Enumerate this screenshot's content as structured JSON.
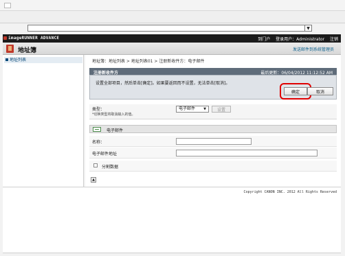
{
  "appbar": {
    "logo": "imageRUNNER ADVANCE",
    "portal": "到门户",
    "login_user_label": "登录用户：",
    "user": "Administrator",
    "logout": "注销"
  },
  "banner": {
    "title": "地址簿",
    "link": "发送邮件到系统管理员"
  },
  "sidebar": {
    "items": [
      {
        "label": "地址列表"
      }
    ]
  },
  "main": {
    "breadcrumb": "地址簿：地址列表 > 地址列表01 > 注册新收件方：电子邮件",
    "panel": {
      "title": "注册新收件方",
      "last_updated_label": "最后更新：",
      "last_updated": "06/04/2012 11:12:52 AM",
      "message": "设置全部项目，然后单击[确定]。如果要返回而不设置，无法单击[取消]。",
      "ok_label": "确定",
      "cancel_label": "取消"
    },
    "type": {
      "label": "类型：",
      "hint": "*切换类型将取消输入的值。",
      "selected": "电子邮件",
      "set_label": "设置"
    },
    "section": {
      "title": "电子邮件"
    },
    "fields": {
      "name_label": "名称：",
      "email_label": "电子邮件地址",
      "split_label": "分割数据"
    }
  },
  "footer": {
    "copyright": "Copyright CANON INC. 2012 All Rights Reserved"
  },
  "colors": {
    "appbar": "#1b1b1b",
    "panel_header": "#5f6c7a",
    "highlight": "#e00000",
    "link": "#0a5f8c"
  }
}
